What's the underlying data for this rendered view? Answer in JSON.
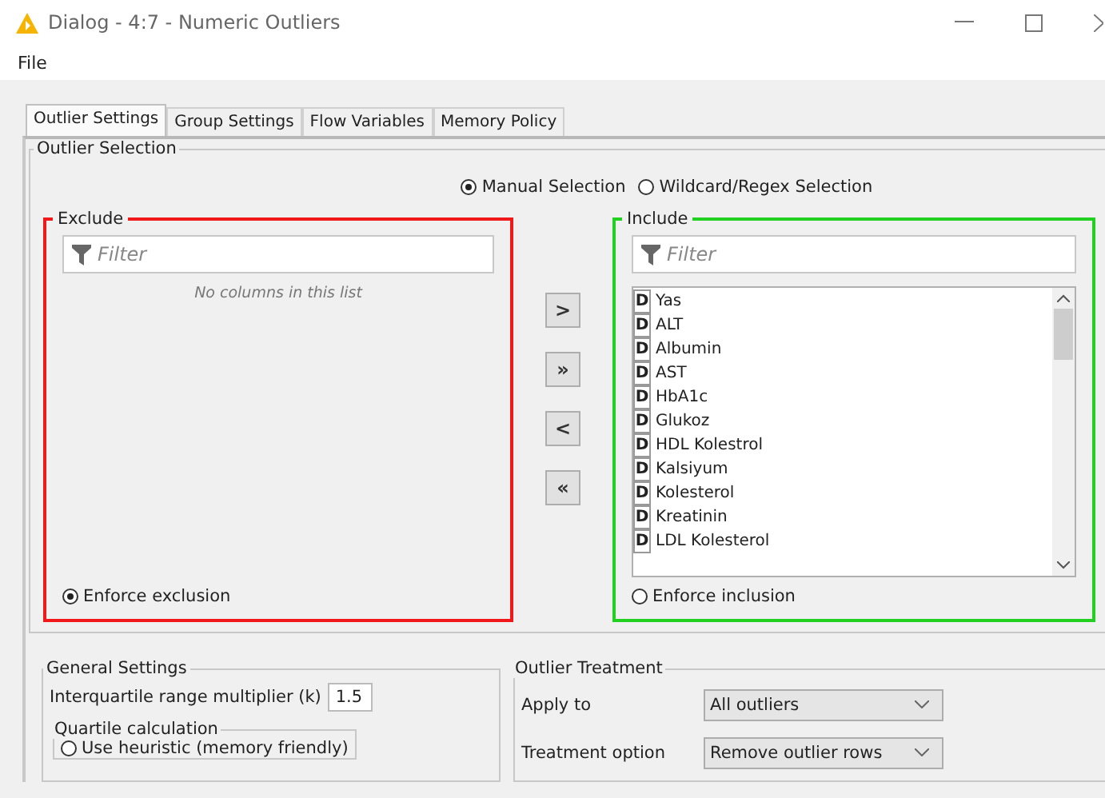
{
  "window": {
    "title": "Dialog - 4:7 - Numeric Outliers"
  },
  "menu": [
    "File"
  ],
  "tabs": [
    {
      "label": "Outlier Settings",
      "selected": true
    },
    {
      "label": "Group Settings",
      "selected": false
    },
    {
      "label": "Flow Variables",
      "selected": false
    },
    {
      "label": "Memory Policy",
      "selected": false
    }
  ],
  "outlier_selection": {
    "title": "Outlier Selection",
    "modes": [
      {
        "label": "Manual Selection",
        "selected": true
      },
      {
        "label": "Wildcard/Regex Selection",
        "selected": false
      }
    ],
    "exclude": {
      "title": "Exclude",
      "filter_placeholder": "Filter",
      "empty_message": "No columns in this list",
      "enforce": {
        "label": "Enforce exclusion",
        "selected": true
      }
    },
    "move_buttons": [
      ">",
      "»",
      "<",
      "«"
    ],
    "include": {
      "title": "Include",
      "filter_placeholder": "Filter",
      "columns": [
        {
          "type": "D",
          "name": "Yas"
        },
        {
          "type": "D",
          "name": "ALT"
        },
        {
          "type": "D",
          "name": "Albumin"
        },
        {
          "type": "D",
          "name": "AST"
        },
        {
          "type": "D",
          "name": "HbA1c"
        },
        {
          "type": "D",
          "name": "Glukoz"
        },
        {
          "type": "D",
          "name": "HDL Kolestrol"
        },
        {
          "type": "D",
          "name": "Kalsiyum"
        },
        {
          "type": "D",
          "name": "Kolesterol"
        },
        {
          "type": "D",
          "name": "Kreatinin"
        },
        {
          "type": "D",
          "name": "LDL Kolesterol"
        }
      ],
      "enforce": {
        "label": "Enforce inclusion",
        "selected": false
      }
    }
  },
  "general_settings": {
    "title": "General Settings",
    "multiplier_label": "Interquartile range multiplier (k)",
    "multiplier_value": "1.5",
    "quartile_calculation": {
      "title": "Quartile calculation",
      "options": [
        {
          "label": "Use heuristic (memory friendly)",
          "selected": false
        }
      ]
    }
  },
  "outlier_treatment": {
    "title": "Outlier Treatment",
    "fields": [
      {
        "label": "Apply to",
        "value": "All outliers"
      },
      {
        "label": "Treatment option",
        "value": "Remove outlier rows"
      }
    ]
  }
}
